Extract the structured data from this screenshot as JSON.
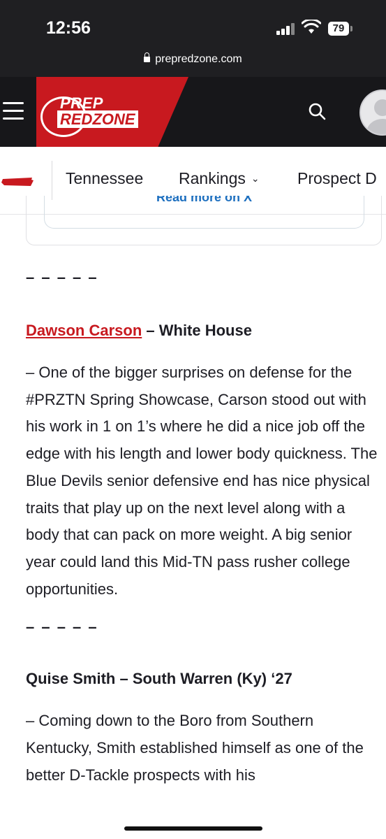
{
  "status_bar": {
    "time": "12:56",
    "battery": "79"
  },
  "browser": {
    "url": "prepredzone.com"
  },
  "site": {
    "logo_top": "PREP",
    "logo_bottom": "REDZONE"
  },
  "nav": {
    "items": [
      "Tennessee",
      "Rankings",
      "Prospect D"
    ]
  },
  "embed": {
    "link_text": "Read more on X"
  },
  "article": {
    "separator": "– – – – –",
    "player1": {
      "name": "Dawson Carson",
      "school": "– White House",
      "text": "– One of the bigger surprises on defense for the #PRZTN Spring Showcase, Carson stood out with his work in 1 on 1’s where he did a nice job off the edge with his length and lower body quickness. The Blue Devils senior defensive end has nice physical traits that play up on the next level along with a body that can pack on more weight. A big senior year could land this Mid-TN pass rusher college opportunities."
    },
    "player2": {
      "heading": "Quise Smith – South Warren (Ky) ‘27",
      "text": "– Coming down to the Boro from Southern Kentucky, Smith established himself as one of the better D-Tackle prospects with his"
    }
  },
  "colors": {
    "brand_red": "#c8191f",
    "header_dark": "#17171a",
    "link_blue": "#1d6fbf"
  }
}
